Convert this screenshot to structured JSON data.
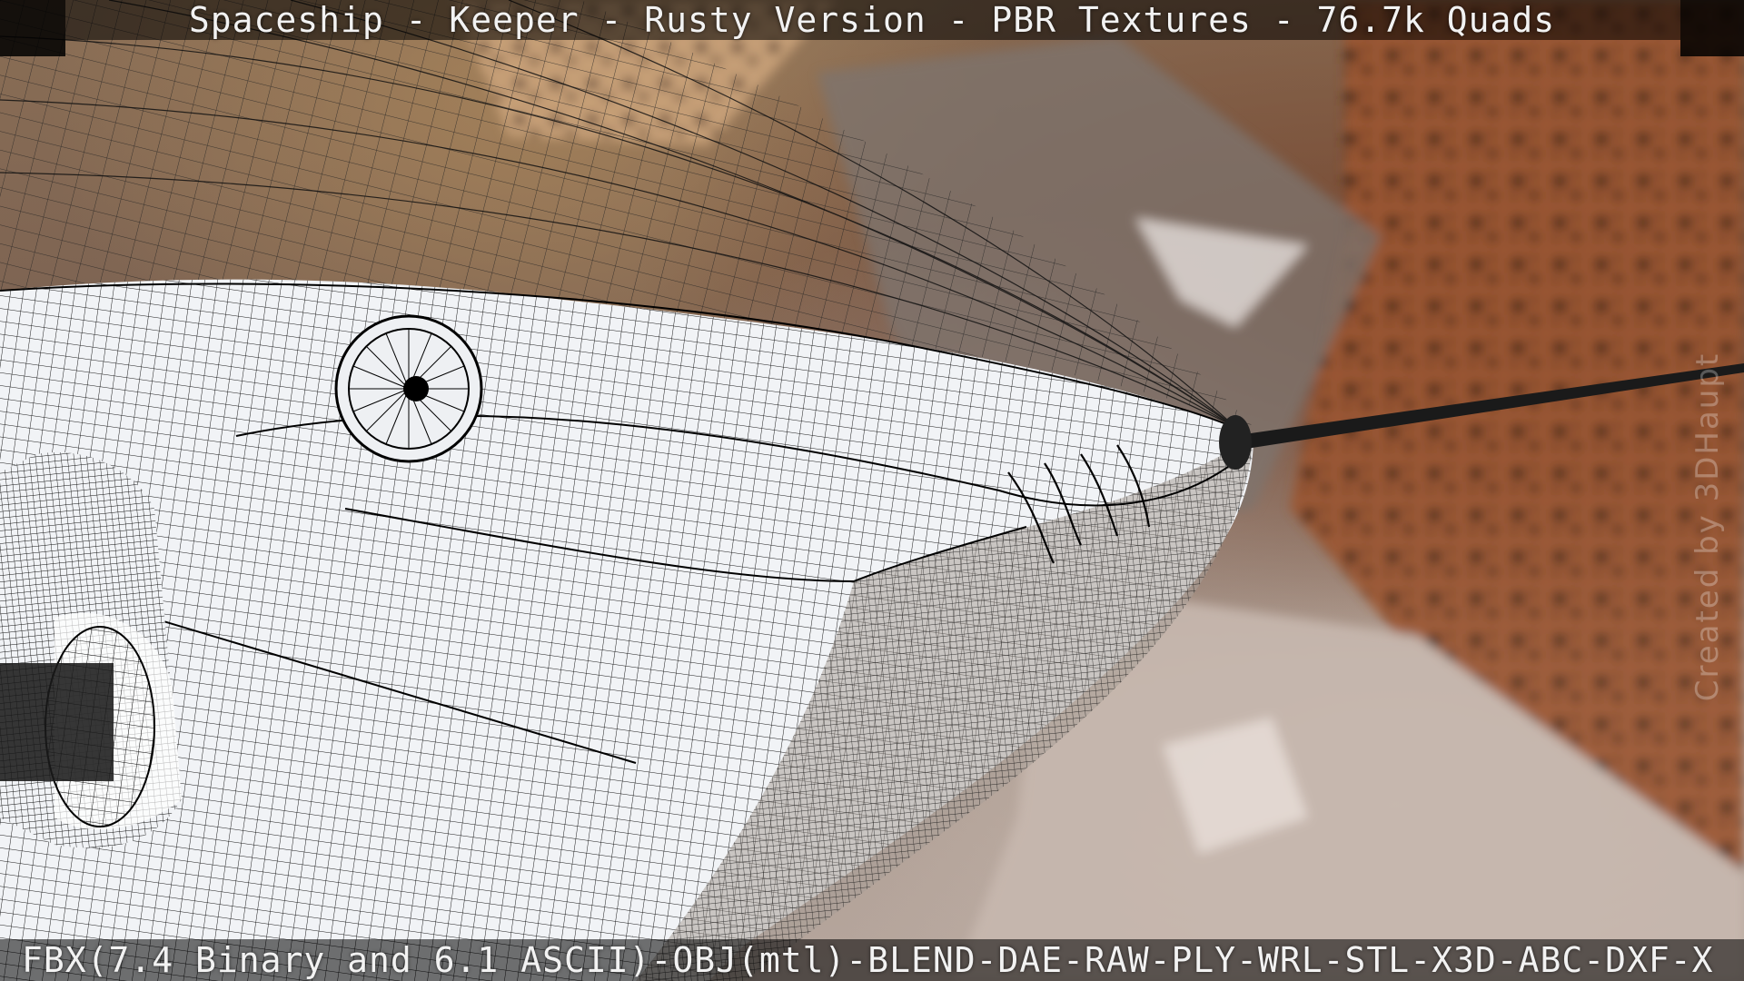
{
  "title": "Spaceship - Keeper - Rusty Version - PBR Textures - 76.7k Quads",
  "formats": "FBX(7.4 Binary and 6.1 ASCII)-OBJ(mtl)-BLEND-DAE-RAW-PLY-WRL-STL-X3D-ABC-DXF-X",
  "watermark": "Created by 3DHaupt",
  "colors": {
    "wire": "#000000",
    "hull_fill": "#f4f5f7",
    "rust": "#8b4a2c",
    "background": "#7a6152"
  }
}
